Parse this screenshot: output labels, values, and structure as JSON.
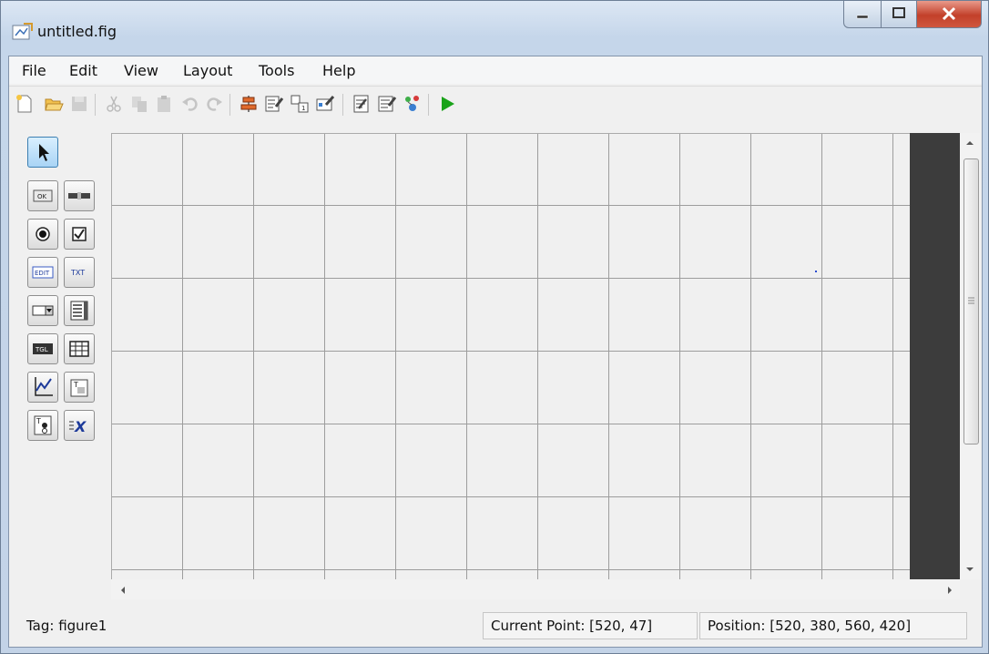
{
  "window": {
    "title": "untitled.fig",
    "icon": "figure-file-icon"
  },
  "menu": [
    "File",
    "Edit",
    "View",
    "Layout",
    "Tools",
    "Help"
  ],
  "toolbar": [
    {
      "icon": "new-figure-icon",
      "enabled": true
    },
    {
      "icon": "open-file-icon",
      "enabled": true
    },
    {
      "icon": "save-icon",
      "enabled": false
    },
    {
      "icon": "cut-icon",
      "enabled": false
    },
    {
      "icon": "copy-icon",
      "enabled": false
    },
    {
      "icon": "paste-icon",
      "enabled": false
    },
    {
      "icon": "undo-icon",
      "enabled": false
    },
    {
      "icon": "redo-icon",
      "enabled": false
    },
    {
      "icon": "align-objects-icon",
      "enabled": true
    },
    {
      "icon": "menu-editor-icon",
      "enabled": true
    },
    {
      "icon": "tab-order-editor-icon",
      "enabled": true
    },
    {
      "icon": "toolbar-editor-icon",
      "enabled": true
    },
    {
      "icon": "mfile-editor-icon",
      "enabled": true
    },
    {
      "icon": "property-inspector-icon",
      "enabled": true
    },
    {
      "icon": "object-browser-icon",
      "enabled": true
    },
    {
      "icon": "run-figure-icon",
      "enabled": true
    }
  ],
  "palette": {
    "select_tool": {
      "icon": "select-arrow-icon",
      "selected": true
    },
    "components": [
      {
        "icon": "push-button-icon",
        "glyph": "OK"
      },
      {
        "icon": "slider-icon",
        "glyph": ""
      },
      {
        "icon": "radio-button-icon",
        "glyph": ""
      },
      {
        "icon": "check-box-icon",
        "glyph": "☑"
      },
      {
        "icon": "edit-text-icon",
        "glyph": "EDIT"
      },
      {
        "icon": "static-text-icon",
        "glyph": "TXT"
      },
      {
        "icon": "pop-up-menu-icon",
        "glyph": ""
      },
      {
        "icon": "listbox-icon",
        "glyph": ""
      },
      {
        "icon": "toggle-button-icon",
        "glyph": "TGL"
      },
      {
        "icon": "table-icon",
        "glyph": ""
      },
      {
        "icon": "axes-icon",
        "glyph": ""
      },
      {
        "icon": "panel-icon",
        "glyph": "T"
      },
      {
        "icon": "button-group-icon",
        "glyph": "T"
      },
      {
        "icon": "activex-control-icon",
        "glyph": "X"
      }
    ]
  },
  "status": {
    "tag": "Tag: figure1",
    "current_point": "Current Point:  [520, 47]",
    "position": "Position: [520, 380, 560, 420]"
  },
  "colors": {
    "title_gradient_top": "#dce7f4",
    "close_button": "#c2402a",
    "canvas_bg": "#f0f0f0",
    "grid_line": "#9d9d9d",
    "run_green": "#1aa31a"
  }
}
